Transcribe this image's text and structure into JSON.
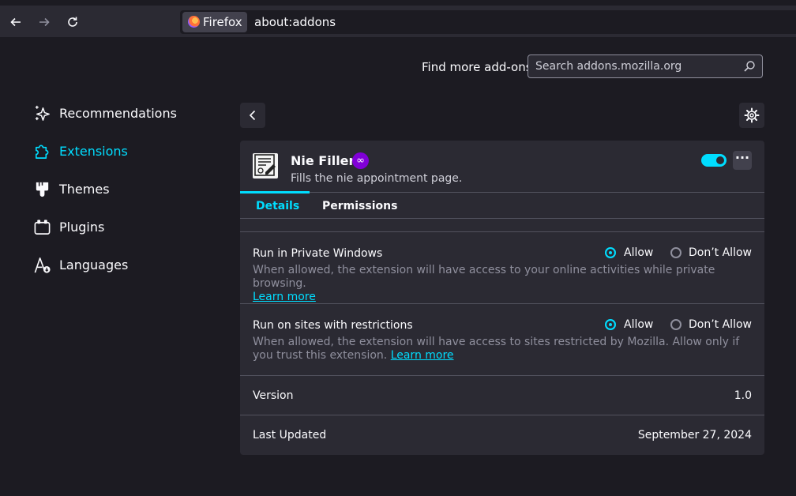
{
  "browser": {
    "identity_label": "Firefox",
    "url": "about:addons"
  },
  "search": {
    "find_more_label": "Find more add-ons",
    "placeholder": "Search addons.mozilla.org"
  },
  "sidebar": {
    "items": [
      {
        "label": "Recommendations",
        "icon": "sparkle-icon",
        "active": false
      },
      {
        "label": "Extensions",
        "icon": "puzzle-icon",
        "active": true
      },
      {
        "label": "Themes",
        "icon": "paintbrush-icon",
        "active": false
      },
      {
        "label": "Plugins",
        "icon": "plugin-icon",
        "active": false
      },
      {
        "label": "Languages",
        "icon": "language-icon",
        "active": false
      }
    ]
  },
  "addon": {
    "name": "Nie Filler",
    "description": "Fills the nie appointment page.",
    "enabled": true,
    "tabs": [
      "Details",
      "Permissions"
    ],
    "private_windows": {
      "label": "Run in Private Windows",
      "allow_label": "Allow",
      "dont_allow_label": "Don’t Allow",
      "selected": "Allow",
      "description": "When allowed, the extension will have access to your online activities while private browsing.",
      "learn_more": "Learn more"
    },
    "restricted_sites": {
      "label": "Run on sites with restrictions",
      "allow_label": "Allow",
      "dont_allow_label": "Don’t Allow",
      "selected": "Allow",
      "description": "When allowed, the extension will have access to sites restricted by Mozilla. Allow only if you trust this extension.",
      "learn_more": "Learn more"
    },
    "version": {
      "label": "Version",
      "value": "1.0"
    },
    "last_updated": {
      "label": "Last Updated",
      "value": "September 27, 2024"
    }
  },
  "colors": {
    "accent": "#00ddff",
    "background": "#1c1b22",
    "card": "#2b2a33",
    "private_badge": "#8000d7"
  }
}
